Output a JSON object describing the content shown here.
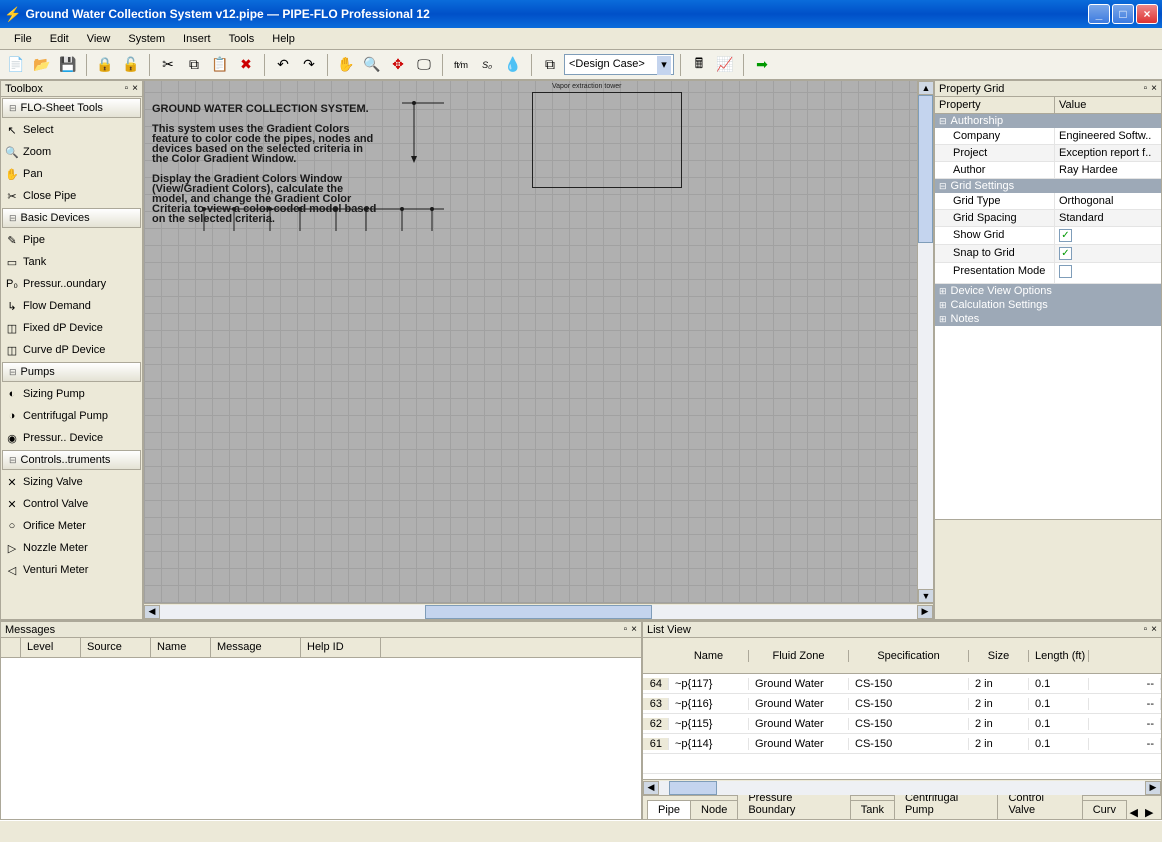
{
  "title": "Ground Water Collection System v12.pipe — PIPE-FLO Professional 12",
  "menu": [
    "File",
    "Edit",
    "View",
    "System",
    "Insert",
    "Tools",
    "Help"
  ],
  "design_case": "<Design Case>",
  "toolbox": {
    "title": "Toolbox",
    "groups": [
      {
        "label": "FLO-Sheet Tools",
        "items": [
          {
            "label": "Select",
            "ic": "↖"
          },
          {
            "label": "Zoom",
            "ic": "🔍"
          },
          {
            "label": "Pan",
            "ic": "✋"
          },
          {
            "label": "Close Pipe",
            "ic": "✂"
          }
        ]
      },
      {
        "label": "Basic Devices",
        "items": [
          {
            "label": "Pipe",
            "ic": "✎"
          },
          {
            "label": "Tank",
            "ic": "▭"
          },
          {
            "label": "Pressur..oundary",
            "ic": "P₀"
          },
          {
            "label": "Flow Demand",
            "ic": "↳"
          },
          {
            "label": "Fixed dP Device",
            "ic": "◫"
          },
          {
            "label": "Curve dP Device",
            "ic": "◫"
          }
        ]
      },
      {
        "label": "Pumps",
        "items": [
          {
            "label": "Sizing Pump",
            "ic": "◐"
          },
          {
            "label": "Centrifugal Pump",
            "ic": "◑"
          },
          {
            "label": "Pressur.. Device",
            "ic": "◉"
          }
        ]
      },
      {
        "label": "Controls..truments",
        "items": [
          {
            "label": "Sizing Valve",
            "ic": "✕"
          },
          {
            "label": "Control Valve",
            "ic": "✕"
          },
          {
            "label": "Orifice Meter",
            "ic": "○"
          },
          {
            "label": "Nozzle Meter",
            "ic": "▷"
          },
          {
            "label": "Venturi Meter",
            "ic": "◁"
          }
        ]
      }
    ]
  },
  "canvas": {
    "vapor_label": "Vapor extraction tower",
    "sys_text": "GROUND WATER COLLECTION SYSTEM.\n\nThis system uses the Gradient Colors feature to color code the pipes, nodes and devices based on the selected criteria in the Color Gradient Window.\n\nDisplay the Gradient Colors Window (View/Gradient Colors), calculate the model, and change the Gradient Color Criteria to view a color-coded model based on the selected criteria."
  },
  "propgrid": {
    "title": "Property Grid",
    "head": [
      "Property",
      "Value"
    ],
    "cats": [
      {
        "name": "Authorship",
        "rows": [
          [
            "Company",
            "Engineered Softw.."
          ],
          [
            "Project",
            "Exception report f.."
          ],
          [
            "Author",
            "Ray Hardee"
          ]
        ]
      },
      {
        "name": "Grid Settings",
        "rows": [
          [
            "Grid Type",
            "Orthogonal"
          ],
          [
            "Grid Spacing",
            "Standard"
          ],
          [
            "Show Grid",
            "✓"
          ],
          [
            "Snap to Grid",
            "✓"
          ],
          [
            "Presentation Mode",
            ""
          ]
        ]
      }
    ],
    "collapsed": [
      "Device View Options",
      "Calculation Settings",
      "Notes"
    ]
  },
  "messages": {
    "title": "Messages",
    "cols": [
      "",
      "Level",
      "Source",
      "Name",
      "Message",
      "Help ID"
    ]
  },
  "listview": {
    "title": "List View",
    "cols": [
      "",
      "Name",
      "Fluid Zone",
      "Specification",
      "Size",
      "Length (ft)",
      ""
    ],
    "rows": [
      [
        "64",
        "~p{117}",
        "Ground Water",
        "CS-150",
        "2 in",
        "0.1",
        "--"
      ],
      [
        "63",
        "~p{116}",
        "Ground Water",
        "CS-150",
        "2 in",
        "0.1",
        "--"
      ],
      [
        "62",
        "~p{115}",
        "Ground Water",
        "CS-150",
        "2 in",
        "0.1",
        "--"
      ],
      [
        "61",
        "~p{114}",
        "Ground Water",
        "CS-150",
        "2 in",
        "0.1",
        "--"
      ]
    ],
    "tabs": [
      "Pipe",
      "Node",
      "Pressure Boundary",
      "Tank",
      "Centrifugal Pump",
      "Control Valve",
      "Curv"
    ]
  }
}
